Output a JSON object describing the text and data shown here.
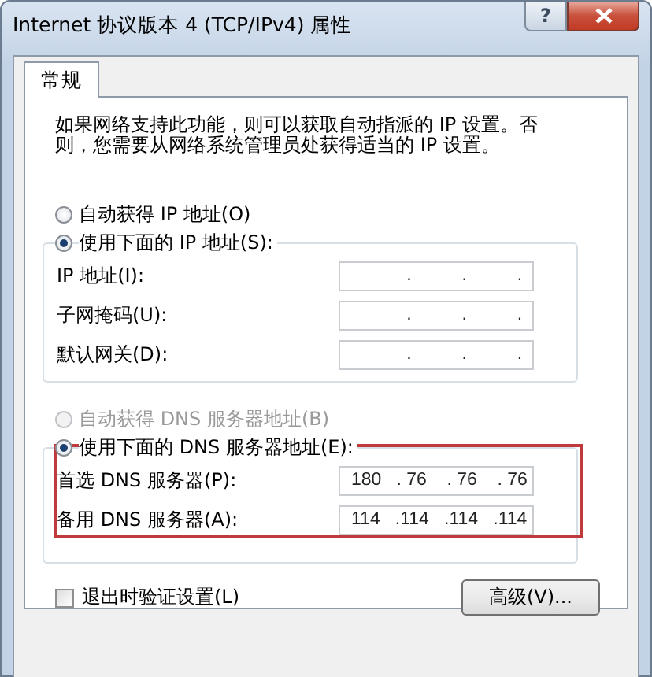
{
  "window": {
    "title": "Internet 协议版本 4 (TCP/IPv4) 属性",
    "help_button": "?"
  },
  "tabs": [
    {
      "label": "常规",
      "selected": true
    }
  ],
  "description": "如果网络支持此功能，则可以获取自动指派的 IP 设置。否则，您需要从网络系统管理员处获得适当的 IP 设置。",
  "ip_section": {
    "radios": [
      {
        "label": "自动获得 IP 地址(O)",
        "selected": false,
        "disabled": false
      },
      {
        "label": "使用下面的 IP 地址(S):",
        "selected": true,
        "disabled": false
      }
    ],
    "fields": [
      {
        "label": "IP 地址(I):",
        "value": "           .          .          ."
      },
      {
        "label": "子网掩码(U):",
        "value": "           .          .          ."
      },
      {
        "label": "默认网关(D):",
        "value": "           .          .          ."
      }
    ]
  },
  "dns_section": {
    "radios": [
      {
        "label": "自动获得 DNS 服务器地址(B)",
        "selected": false,
        "disabled": true
      },
      {
        "label": "使用下面的 DNS 服务器地址(E):",
        "selected": true,
        "disabled": false
      }
    ],
    "fields": [
      {
        "label": "首选 DNS 服务器(P):",
        "value": "180   . 76    . 76    . 76"
      },
      {
        "label": "备用 DNS 服务器(A):",
        "value": "114   .114   .114   .114"
      }
    ],
    "highlighted": true
  },
  "validate_checkbox": {
    "label": "退出时验证设置(L)",
    "checked": false
  },
  "advanced_button": "高级(V)..."
}
